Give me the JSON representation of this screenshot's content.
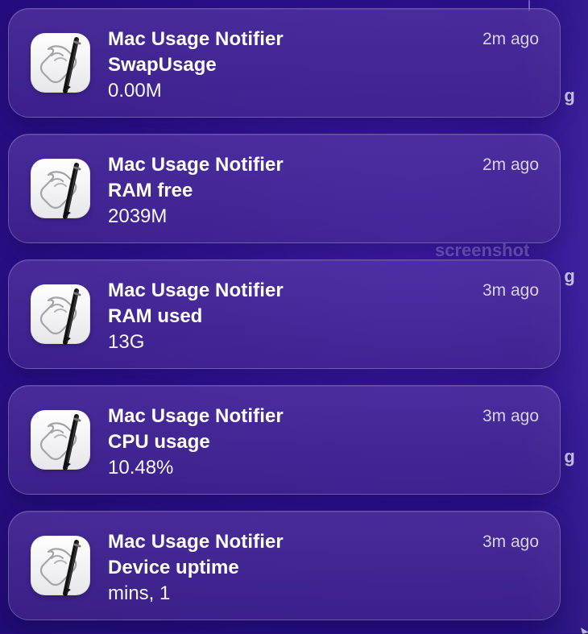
{
  "background": {
    "right_glimpse": [
      "g",
      "g",
      "g"
    ],
    "faint_text": "screenshot"
  },
  "notifications": [
    {
      "app": "Mac Usage Notifier",
      "title": "SwapUsage",
      "body": "0.00M",
      "time": "2m ago",
      "icon": "script-editor-icon"
    },
    {
      "app": "Mac Usage Notifier",
      "title": "RAM free",
      "body": "2039M",
      "time": "2m ago",
      "icon": "script-editor-icon"
    },
    {
      "app": "Mac Usage Notifier",
      "title": "RAM used",
      "body": "13G",
      "time": "3m ago",
      "icon": "script-editor-icon"
    },
    {
      "app": "Mac Usage Notifier",
      "title": "CPU usage",
      "body": "10.48%",
      "time": "3m ago",
      "icon": "script-editor-icon"
    },
    {
      "app": "Mac Usage Notifier",
      "title": "Device uptime",
      "body": "mins, 1",
      "time": "3m ago",
      "icon": "script-editor-icon"
    }
  ],
  "theme": {
    "background": "#2a0f8c",
    "card": "#4a2f91",
    "text": "#ffffff"
  }
}
